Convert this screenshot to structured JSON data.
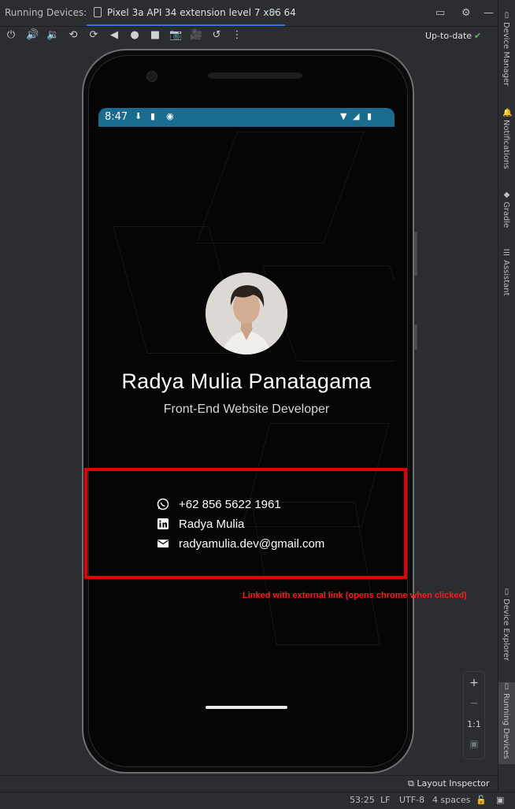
{
  "ide": {
    "panel_title": "Running Devices:",
    "tab_label": "Pixel 3a API 34 extension level 7 x86 64",
    "tab_close": "×",
    "status": "Up-to-date",
    "status_check": "✔",
    "layout_inspector": "Layout Inspector",
    "statusbar": {
      "position": "53:25",
      "line_ending": "LF",
      "encoding": "UTF-8",
      "indent": "4 spaces"
    },
    "right_tools": [
      "Device Manager",
      "Notifications",
      "Gradle",
      "Assistant",
      "Device Explorer",
      "Running Devices"
    ],
    "zoom": {
      "in": "+",
      "out": "−",
      "actual": "1:1"
    }
  },
  "toolbar_icons": [
    "power-icon",
    "volume-up-icon",
    "volume-down-icon",
    "rotate-left-icon",
    "rotate-right-icon",
    "back-icon",
    "home-icon",
    "overview-icon",
    "screenshot-icon",
    "record-icon",
    "snapshot-icon",
    "more-icon"
  ],
  "device": {
    "time": "8:47"
  },
  "profile": {
    "name": "Radya Mulia Panatagama",
    "role": "Front-End Website Developer",
    "contacts": [
      {
        "icon": "whatsapp-icon",
        "text": "+62 856 5622 1961"
      },
      {
        "icon": "linkedin-icon",
        "text": "Radya Mulia"
      },
      {
        "icon": "email-icon",
        "text": "radyamulia.dev@gmail.com"
      }
    ]
  },
  "annotation": "Linked with external link (opens chrome when clicked)",
  "colors": {
    "highlight": "#e00000",
    "status_bar": "#1a6c8f",
    "accent": "#3574f0"
  }
}
